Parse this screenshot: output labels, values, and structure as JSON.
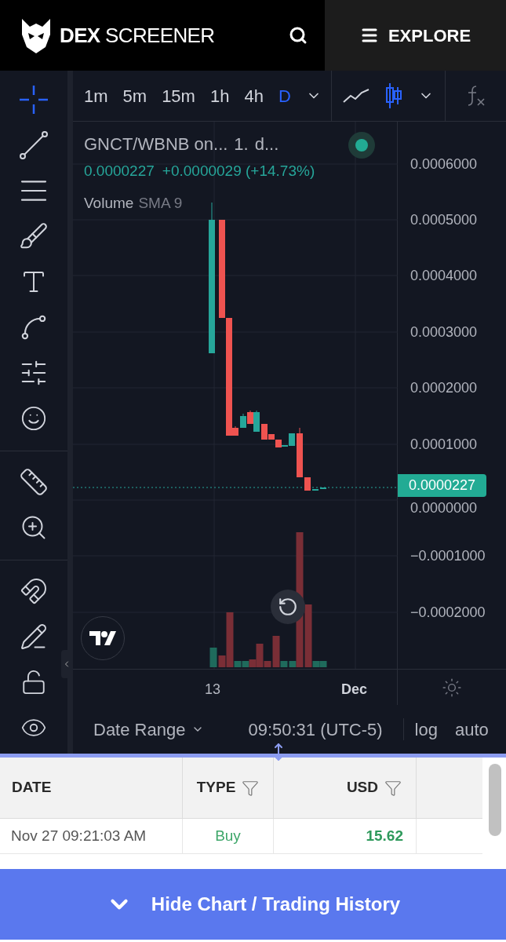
{
  "header": {
    "brand": [
      "DEX",
      "SCREENER"
    ],
    "explore": "EXPLORE"
  },
  "toolbar": {
    "timeframes": [
      {
        "label": "1m",
        "selected": false
      },
      {
        "label": "5m",
        "selected": false
      },
      {
        "label": "15m",
        "selected": false
      },
      {
        "label": "1h",
        "selected": false
      },
      {
        "label": "4h",
        "selected": false
      },
      {
        "label": "D",
        "selected": true
      }
    ],
    "chart_types": [
      {
        "kind": "line",
        "selected": false
      },
      {
        "kind": "candles",
        "selected": true
      }
    ]
  },
  "legend": {
    "symbol": "GNCT/WBNB on...",
    "interval": "1.",
    "exchange": "d...",
    "price": "0.0000227",
    "change": "+0.0000029 (+14.73%)",
    "volume_label": "Volume",
    "volume_indicator": "SMA 9"
  },
  "price_axis": [
    "0.0006000",
    "0.0005000",
    "0.0004000",
    "0.0003000",
    "0.0002000",
    "0.0001000",
    "0.0000000",
    "−0.0001000",
    "−0.0002000"
  ],
  "last_price": "0.0000227",
  "time_axis": [
    "13",
    "Dec"
  ],
  "bottom_bar": {
    "date_range": "Date Range",
    "time": "09:50:31 (UTC-5)",
    "log": "log",
    "auto": "auto"
  },
  "table": {
    "columns": [
      {
        "label": "DATE",
        "filter": false
      },
      {
        "label": "TYPE",
        "filter": true
      },
      {
        "label": "USD",
        "filter": true
      }
    ],
    "rows": [
      {
        "date": "Nov 27 09:21:03 AM",
        "type": "Buy",
        "kind": "buy",
        "usd": "15.62"
      }
    ]
  },
  "hide_button": "Hide Chart / Trading History"
}
